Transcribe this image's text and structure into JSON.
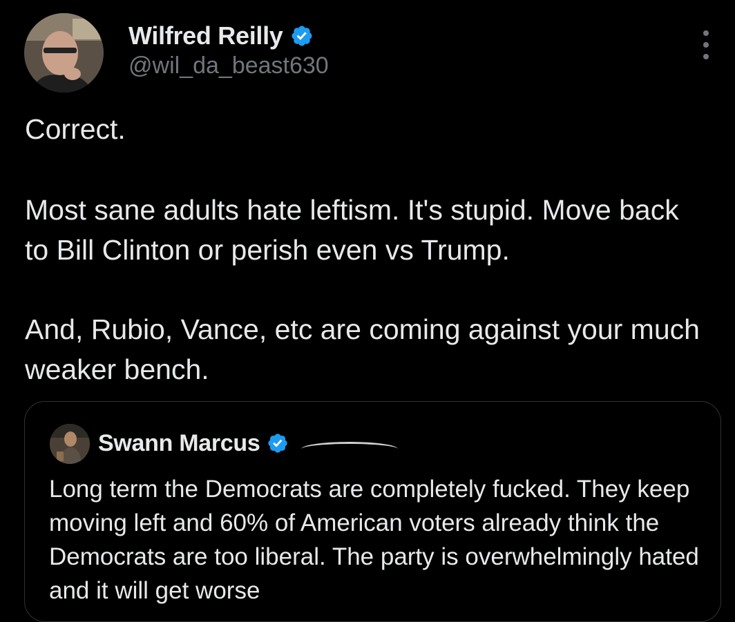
{
  "author": {
    "display_name": "Wilfred Reilly",
    "handle": "@wil_da_beast630",
    "verified": true,
    "avatar_icon": "profile-photo"
  },
  "tweet": {
    "paragraphs": [
      "Correct.",
      "Most sane adults hate leftism. It's stupid. Move back to Bill Clinton or perish even vs Trump.",
      "And, Rubio, Vance, etc are coming against your much weaker bench."
    ]
  },
  "quoted_tweet": {
    "display_name": "Swann Marcus",
    "verified": true,
    "avatar_icon": "profile-photo",
    "text": "Long term the Democrats are completely fucked. They keep moving left and 60% of American voters already think the Democrats are too liberal. The party is overwhelmingly hated and it will get worse"
  },
  "colors": {
    "background": "#000000",
    "text_primary": "#e7e9ea",
    "text_secondary": "#71767b",
    "verified_blue": "#1d9bf0",
    "border": "#2f3336"
  },
  "icons": {
    "verified": "verified-badge-icon",
    "more": "more-options-icon"
  }
}
